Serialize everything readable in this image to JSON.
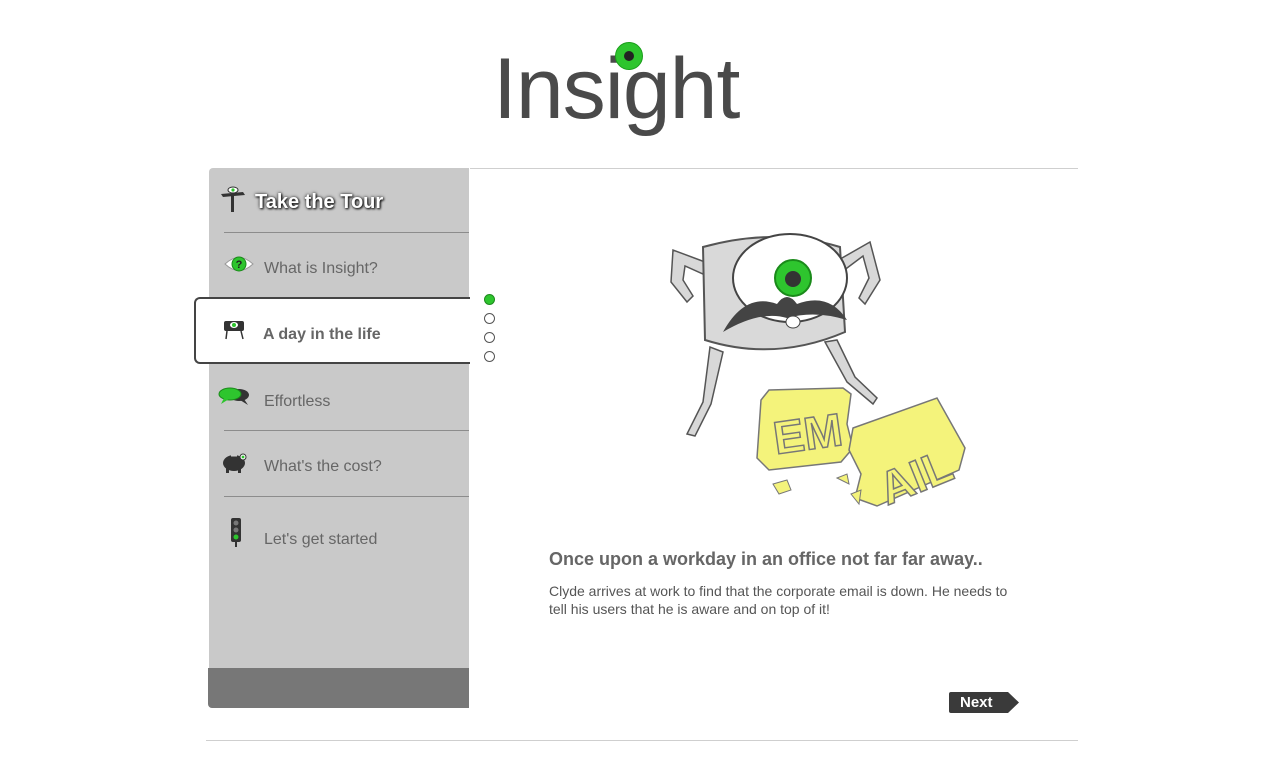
{
  "brand": {
    "logo_text": "Insight",
    "accent_color": "#2ec52e"
  },
  "sidebar": {
    "title": "Take the Tour",
    "items": [
      {
        "label": "What is Insight?",
        "icon": "eye-question-icon"
      },
      {
        "label": "A day in the life",
        "icon": "monster-icon",
        "active": true
      },
      {
        "label": "Effortless",
        "icon": "speech-bubbles-icon"
      },
      {
        "label": "What's the cost?",
        "icon": "piggy-bank-icon"
      },
      {
        "label": "Let's get started",
        "icon": "traffic-light-icon"
      }
    ]
  },
  "pager": {
    "count": 4,
    "current": 1
  },
  "content": {
    "headline": "Once upon a workday in an office not far far away..",
    "body": "Clyde arrives at work to find that the corporate email is down. He needs to tell his users that he is aware and on top of it!",
    "illustration_label": "EMAIL"
  },
  "actions": {
    "next_label": "Next"
  }
}
